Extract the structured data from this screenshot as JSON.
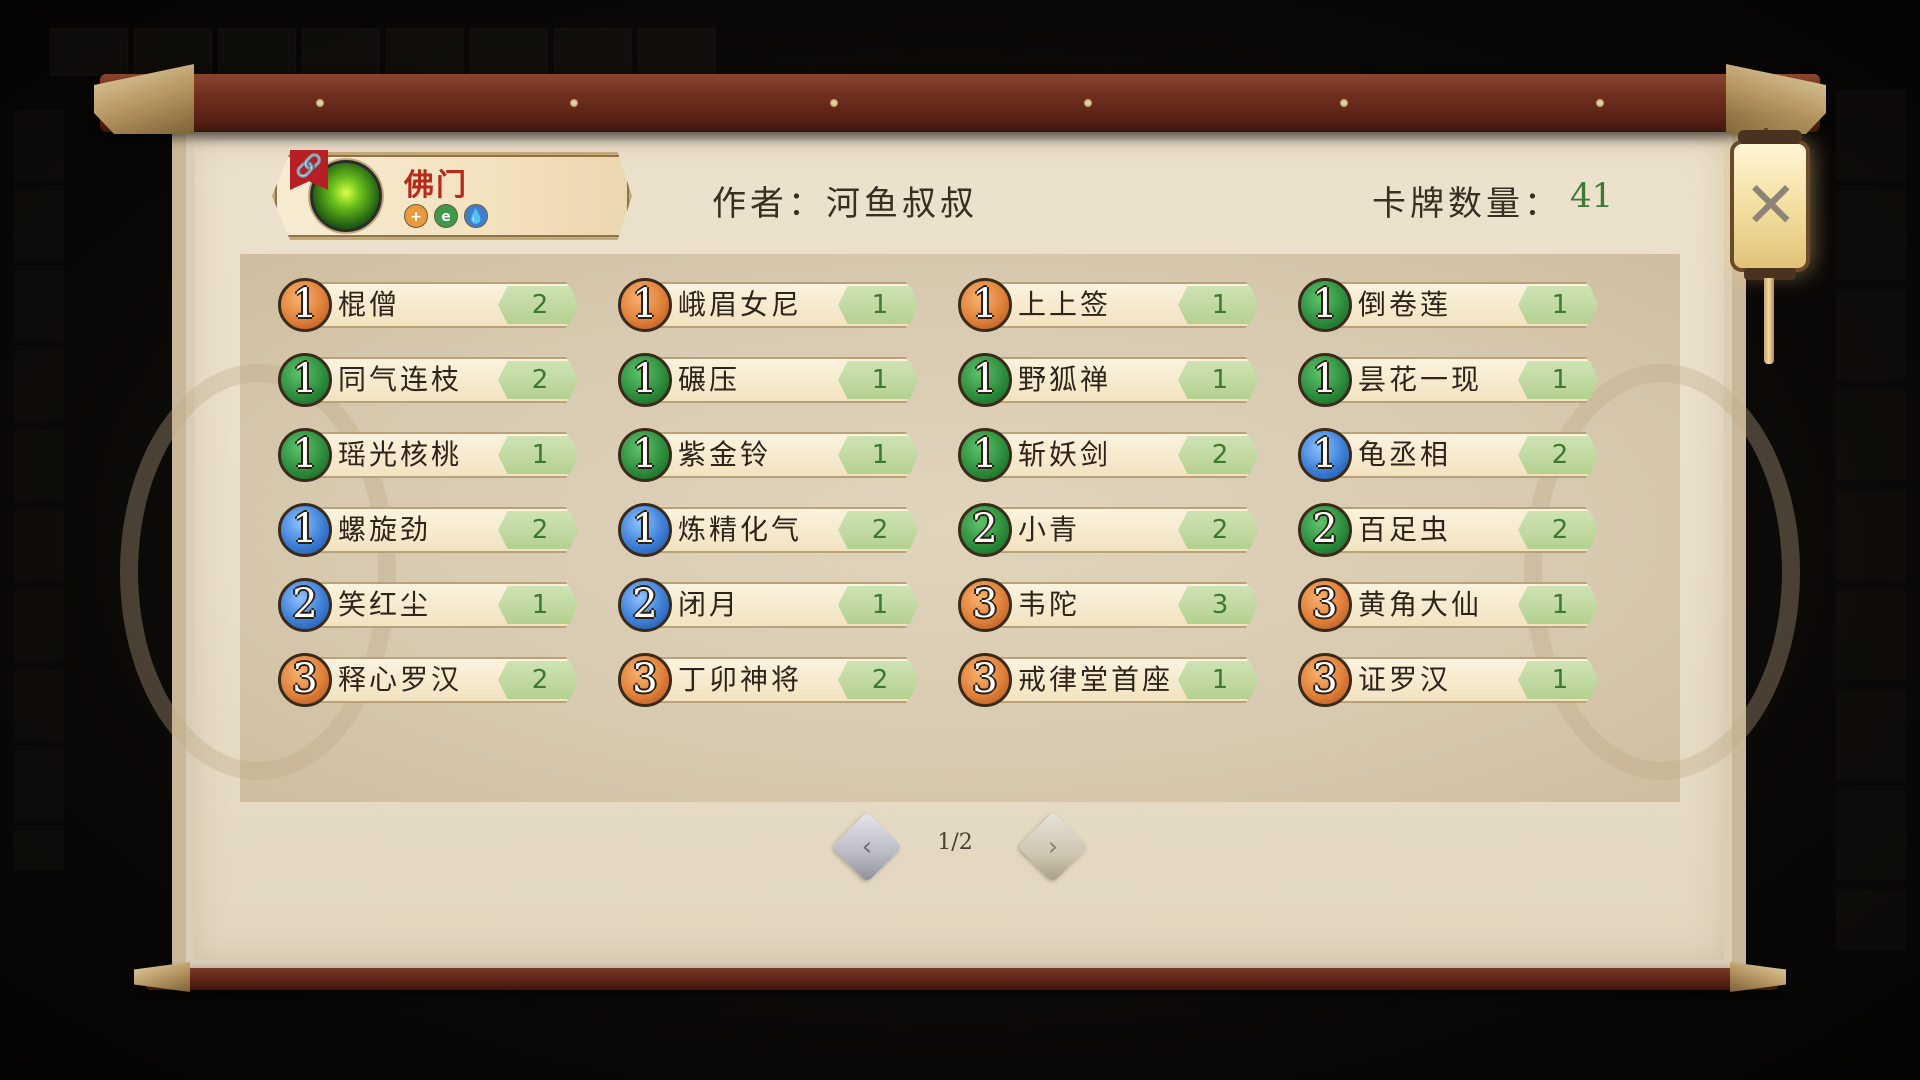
{
  "faction": {
    "name": "佛门",
    "flag_glyph": "🔗",
    "element_icons": [
      {
        "glyph": "+",
        "color": "#e79b3e",
        "icon": "fire-element-icon"
      },
      {
        "glyph": "e",
        "color": "#3c9a4a",
        "icon": "wood-element-icon"
      },
      {
        "glyph": "💧",
        "color": "#3f7fd0",
        "icon": "water-element-icon"
      }
    ]
  },
  "author": "作者：河鱼叔叔",
  "card_count": {
    "label": "卡牌数量：",
    "value": "41"
  },
  "close_glyph": "✕",
  "cards": [
    {
      "cost": "1",
      "color": "orange",
      "name": "棍僧",
      "count": "2"
    },
    {
      "cost": "1",
      "color": "orange",
      "name": "峨眉女尼",
      "count": "1"
    },
    {
      "cost": "1",
      "color": "orange",
      "name": "上上签",
      "count": "1"
    },
    {
      "cost": "1",
      "color": "green",
      "name": "倒卷莲",
      "count": "1"
    },
    {
      "cost": "1",
      "color": "green",
      "name": "同气连枝",
      "count": "2"
    },
    {
      "cost": "1",
      "color": "green",
      "name": "碾压",
      "count": "1"
    },
    {
      "cost": "1",
      "color": "green",
      "name": "野狐禅",
      "count": "1"
    },
    {
      "cost": "1",
      "color": "green",
      "name": "昙花一现",
      "count": "1"
    },
    {
      "cost": "1",
      "color": "green",
      "name": "瑶光核桃",
      "count": "1"
    },
    {
      "cost": "1",
      "color": "green",
      "name": "紫金铃",
      "count": "1"
    },
    {
      "cost": "1",
      "color": "green",
      "name": "斩妖剑",
      "count": "2"
    },
    {
      "cost": "1",
      "color": "blue",
      "name": "龟丞相",
      "count": "2"
    },
    {
      "cost": "1",
      "color": "blue",
      "name": "螺旋劲",
      "count": "2"
    },
    {
      "cost": "1",
      "color": "blue",
      "name": "炼精化气",
      "count": "2"
    },
    {
      "cost": "2",
      "color": "green",
      "name": "小青",
      "count": "2"
    },
    {
      "cost": "2",
      "color": "green",
      "name": "百足虫",
      "count": "2"
    },
    {
      "cost": "2",
      "color": "blue",
      "name": "笑红尘",
      "count": "1"
    },
    {
      "cost": "2",
      "color": "blue",
      "name": "闭月",
      "count": "1"
    },
    {
      "cost": "3",
      "color": "orange",
      "name": "韦陀",
      "count": "3"
    },
    {
      "cost": "3",
      "color": "orange",
      "name": "黄角大仙",
      "count": "1"
    },
    {
      "cost": "3",
      "color": "orange",
      "name": "释心罗汉",
      "count": "2"
    },
    {
      "cost": "3",
      "color": "orange",
      "name": "丁卯神将",
      "count": "2"
    },
    {
      "cost": "3",
      "color": "orange",
      "name": "戒律堂首座",
      "count": "1"
    },
    {
      "cost": "3",
      "color": "orange",
      "name": "证罗汉",
      "count": "1"
    }
  ],
  "pagination": {
    "current": "1/2",
    "prev_glyph": "‹",
    "next_glyph": "›"
  },
  "colors": {
    "accent_red": "#b82b1c",
    "count_green": "#3f7a34"
  }
}
